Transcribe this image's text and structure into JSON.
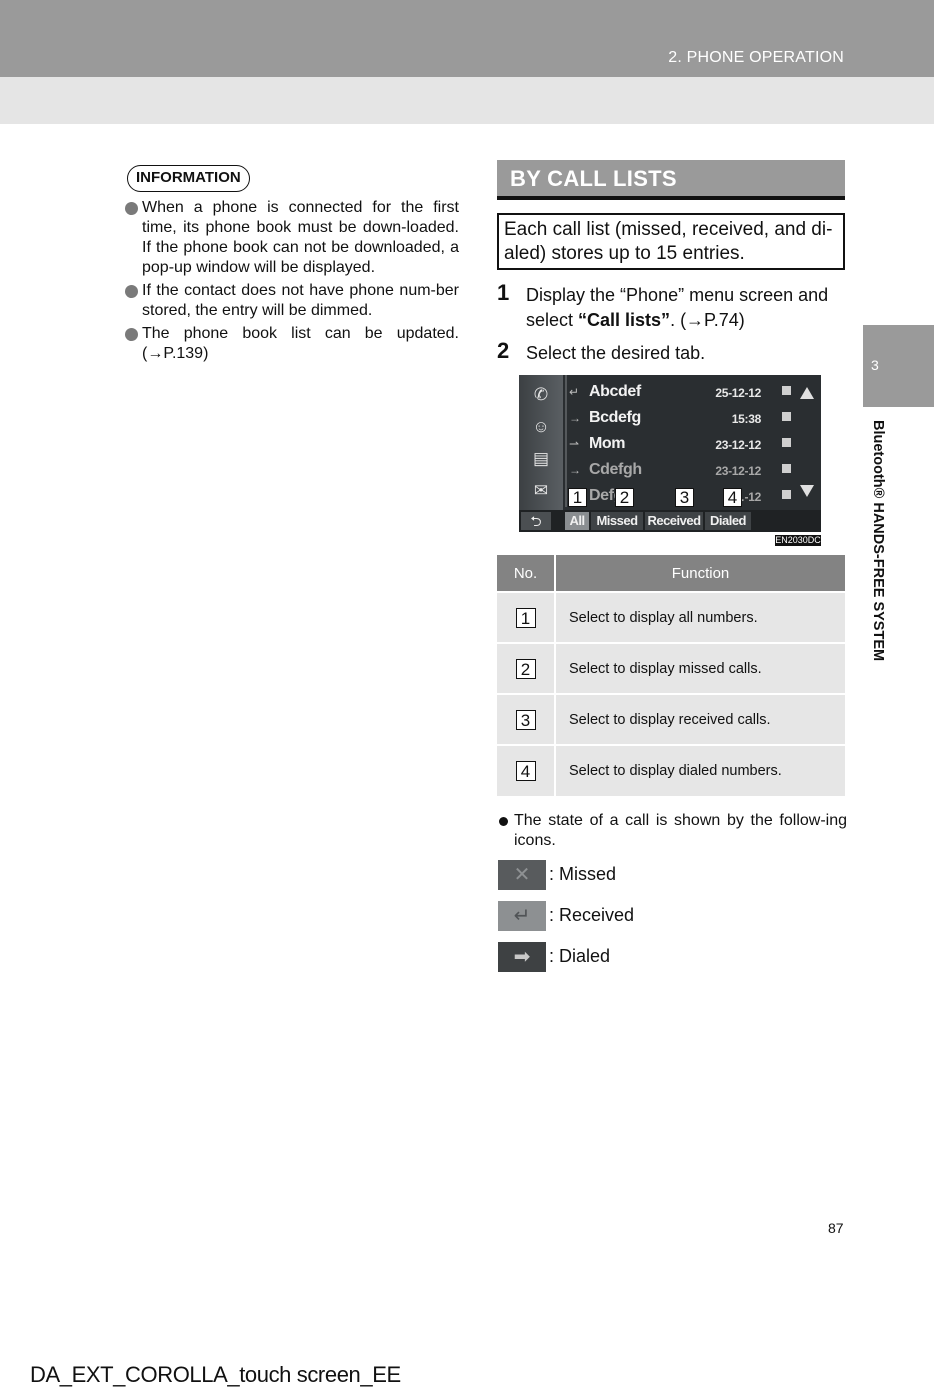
{
  "header": {
    "chapter": "2. PHONE OPERATION"
  },
  "side_tab": {
    "number": "3",
    "title": "Bluetooth® HANDS-FREE SYSTEM"
  },
  "information": {
    "label": "INFORMATION",
    "items": [
      "When a phone is connected for the first time, its phone book must be down-loaded. If the phone book can not be downloaded, a pop-up window will be displayed.",
      "If the contact does not have phone num-ber stored, the entry will be dimmed.",
      "The phone book list can be updated. (→P.139)"
    ]
  },
  "section": {
    "title": "BY CALL LISTS",
    "note": "Each call list (missed, received, and di-aled) stores up to 15 entries.",
    "steps": [
      {
        "number": "1",
        "text_before": "Display the “Phone” menu screen and select ",
        "bold": "“Call lists”",
        "text_after": ". (→P.74)"
      },
      {
        "number": "2",
        "text": "Select the desired tab."
      }
    ]
  },
  "screen": {
    "rail_icons": [
      "phone-icon",
      "contacts-icon",
      "messages-icon",
      "email-icon"
    ],
    "back_label": "⮌",
    "entries": [
      {
        "type": "received",
        "type_glyph": "↵",
        "name": "Abcdef",
        "date": "25-12-12",
        "dimmed": false
      },
      {
        "type": "dialed",
        "type_glyph": "→",
        "name": "Bcdefg",
        "date": "15:38",
        "dimmed": false
      },
      {
        "type": "missed",
        "type_glyph": "⇀",
        "name": "Mom",
        "date": "23-12-12",
        "dimmed": false
      },
      {
        "type": "dialed",
        "type_glyph": "→",
        "name": "Cdefgh",
        "date": "23-12-12",
        "dimmed": true
      },
      {
        "type": "dialed",
        "type_glyph": "→",
        "name": "Defg",
        "date": "2…-12",
        "dimmed": true
      }
    ],
    "tabs": [
      {
        "label": "All",
        "active": true
      },
      {
        "label": "Missed",
        "active": false
      },
      {
        "label": "Received",
        "active": false
      },
      {
        "label": "Dialed",
        "active": false
      }
    ],
    "callouts": [
      "1",
      "2",
      "3",
      "4"
    ],
    "image_code": "EN2030DC"
  },
  "function_table": {
    "headers": [
      "No.",
      "Function"
    ],
    "rows": [
      {
        "no": "1",
        "function": "Select to display all numbers."
      },
      {
        "no": "2",
        "function": "Select to display missed calls."
      },
      {
        "no": "3",
        "function": "Select to display received calls."
      },
      {
        "no": "4",
        "function": "Select to display dialed numbers."
      }
    ]
  },
  "call_states": {
    "intro": "The state of a call is shown by the follow-ing icons.",
    "items": [
      {
        "icon": "missed-x-icon",
        "glyph": "✕",
        "label": ": Missed",
        "color": "#585b5d"
      },
      {
        "icon": "received-arrow-icon",
        "glyph": "↵",
        "label": ": Received",
        "color": "#8d9092"
      },
      {
        "icon": "dialed-arrow-icon",
        "glyph": "➡",
        "label": ": Dialed",
        "color": "#3e4143"
      }
    ]
  },
  "footer": {
    "page_number": "87",
    "document_id": "DA_EXT_COROLLA_touch screen_EE"
  }
}
